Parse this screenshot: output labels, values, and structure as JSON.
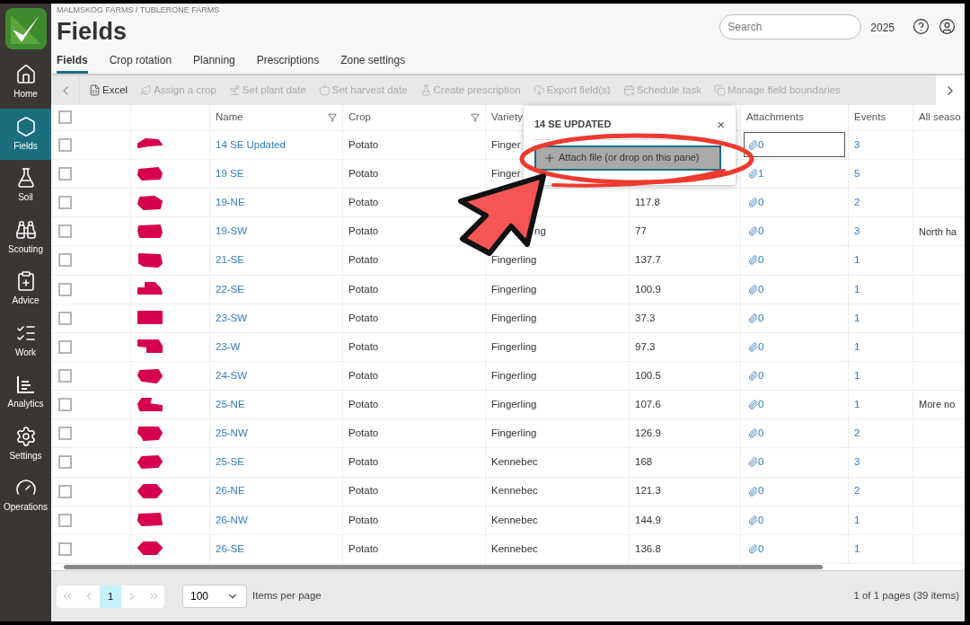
{
  "breadcrumb": "MALMSKOG FARMS / TUBLERONE FARMS",
  "title": "Fields",
  "search": {
    "placeholder": "Search"
  },
  "year": "2025",
  "nav": [
    {
      "label": "Home",
      "selected": false
    },
    {
      "label": "Fields",
      "selected": true
    },
    {
      "label": "Soil",
      "selected": false
    },
    {
      "label": "Scouting",
      "selected": false
    },
    {
      "label": "Advice",
      "selected": false
    },
    {
      "label": "Work",
      "selected": false
    },
    {
      "label": "Analytics",
      "selected": false
    },
    {
      "label": "Settings",
      "selected": false
    },
    {
      "label": "Operations",
      "selected": false
    }
  ],
  "tabs": [
    {
      "label": "Fields",
      "selected": true
    },
    {
      "label": "Crop rotation",
      "selected": false
    },
    {
      "label": "Planning",
      "selected": false
    },
    {
      "label": "Prescriptions",
      "selected": false
    },
    {
      "label": "Zone settings",
      "selected": false
    }
  ],
  "toolbar": [
    {
      "label": "Excel",
      "disabled": false
    },
    {
      "label": "Assign a crop",
      "disabled": true
    },
    {
      "label": "Set plant date",
      "disabled": true
    },
    {
      "label": "Set harvest date",
      "disabled": true
    },
    {
      "label": "Create prescription",
      "disabled": true
    },
    {
      "label": "Export field(s)",
      "disabled": true
    },
    {
      "label": "Schedule task",
      "disabled": true
    },
    {
      "label": "Manage field boundaries",
      "disabled": true
    }
  ],
  "table": {
    "all_checked": false,
    "columns": [
      {
        "label": "Name",
        "filter": true
      },
      {
        "label": "Crop",
        "filter": true
      },
      {
        "label": "Variety"
      },
      {
        "label": "Attachments",
        "filter": false
      },
      {
        "label": "Events",
        "filter": false
      },
      {
        "label": "All seaso"
      }
    ],
    "rows": [
      {
        "name": "14 SE Updated",
        "crop": "Potato",
        "variety": "Finger",
        "attachments": "0",
        "events": "3",
        "focused": true,
        "checked": false
      },
      {
        "name": "19 SE",
        "crop": "Potato",
        "variety": "Finger",
        "attachments": "1",
        "events": "5",
        "focused": false,
        "checked": false
      },
      {
        "name": "19-NE",
        "crop": "Potato",
        "area": "117.8",
        "attachments": "0",
        "events": "2",
        "focused": false,
        "checked": false
      },
      {
        "name": "19-SW",
        "crop": "Potato",
        "variety": "ng",
        "variety_tail": true,
        "area": "77",
        "attachments": "0",
        "events": "3",
        "notes": "North ha",
        "focused": false,
        "checked": false
      },
      {
        "name": "21-SE",
        "crop": "Potato",
        "variety": "Fingerling",
        "area": "137.7",
        "attachments": "0",
        "events": "1",
        "focused": false,
        "checked": false
      },
      {
        "name": "22-SE",
        "crop": "Potato",
        "variety": "Fingerling",
        "area": "100.9",
        "attachments": "0",
        "events": "1",
        "focused": false,
        "checked": false
      },
      {
        "name": "23-SW",
        "crop": "Potato",
        "variety": "Fingerling",
        "area": "37.3",
        "attachments": "0",
        "events": "1",
        "focused": false,
        "checked": false
      },
      {
        "name": "23-W",
        "crop": "Potato",
        "variety": "Fingerling",
        "area": "97.3",
        "attachments": "0",
        "events": "1",
        "focused": false,
        "checked": false
      },
      {
        "name": "24-SW",
        "crop": "Potato",
        "variety": "Fingerling",
        "area": "100.5",
        "attachments": "0",
        "events": "1",
        "focused": false,
        "checked": false
      },
      {
        "name": "25-NE",
        "crop": "Potato",
        "variety": "Fingerling",
        "area": "107.6",
        "attachments": "0",
        "events": "1",
        "notes": "More no",
        "focused": false,
        "checked": false
      },
      {
        "name": "25-NW",
        "crop": "Potato",
        "variety": "Fingerling",
        "area": "126.9",
        "attachments": "0",
        "events": "2",
        "focused": false,
        "checked": false
      },
      {
        "name": "25-SE",
        "crop": "Potato",
        "variety": "Kennebec",
        "area": "168",
        "attachments": "0",
        "events": "3",
        "focused": false,
        "checked": false
      },
      {
        "name": "26-NE",
        "crop": "Potato",
        "variety": "Kennebec",
        "area": "121.3",
        "attachments": "0",
        "events": "2",
        "focused": false,
        "checked": false
      },
      {
        "name": "26-NW",
        "crop": "Potato",
        "variety": "Kennebec",
        "area": "144.9",
        "attachments": "0",
        "events": "1",
        "focused": false,
        "checked": false
      },
      {
        "name": "26-SE",
        "crop": "Potato",
        "variety": "Kennebec",
        "area": "136.8",
        "attachments": "0",
        "events": "1",
        "focused": false,
        "checked": false
      }
    ]
  },
  "popup": {
    "title": "14 SE UPDATED",
    "close": "×",
    "button": "Attach file (or drop on this pane)"
  },
  "pager": {
    "pages": [
      {
        "label": "1",
        "selected": true
      }
    ],
    "page_size": "100",
    "page_size_label": "Items per page",
    "summary": "1 of 1 pages (39 items)"
  }
}
